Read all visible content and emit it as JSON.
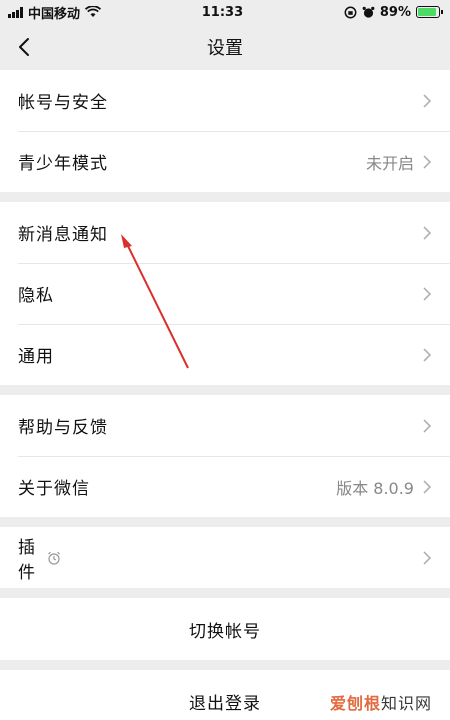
{
  "status_bar": {
    "carrier": "中国移动",
    "time": "11:33",
    "battery_text": "89%",
    "battery_level": 0.89
  },
  "nav": {
    "title": "设置"
  },
  "groups": {
    "account": {
      "account_security": "帐号与安全",
      "teen_mode": "青少年模式",
      "teen_mode_value": "未开启"
    },
    "general": {
      "notifications": "新消息通知",
      "privacy": "隐私",
      "general": "通用"
    },
    "about": {
      "help": "帮助与反馈",
      "about_wechat": "关于微信",
      "version": "版本 8.0.9"
    },
    "plugins": {
      "plugins": "插件"
    }
  },
  "actions": {
    "switch_account": "切换帐号",
    "logout": "退出登录"
  },
  "watermark": {
    "brand": "爱刨根",
    "rest": "知识网"
  },
  "colors": {
    "background": "#ededed",
    "row_background": "#ffffff",
    "annotation_arrow": "#d9302c",
    "battery": "#4cd964"
  }
}
